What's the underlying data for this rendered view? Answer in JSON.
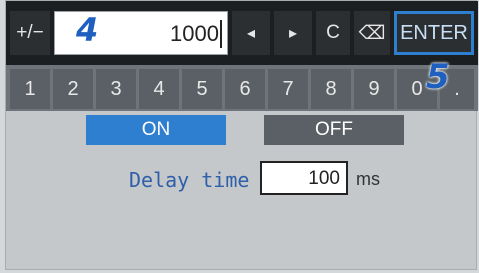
{
  "keypad": {
    "sign_key": "+/−",
    "entry_value": "1000",
    "left_key": "◂",
    "right_key": "▸",
    "clear_key": "C",
    "backspace_key": "⌫",
    "enter_key": "ENTER"
  },
  "callouts": {
    "step_4": "4",
    "step_5": "5"
  },
  "number_keys": [
    "1",
    "2",
    "3",
    "4",
    "5",
    "6",
    "7",
    "8",
    "9",
    "0",
    "."
  ],
  "toggle": {
    "on_label": "ON",
    "off_label": "OFF",
    "selected": "ON"
  },
  "delay": {
    "label": "Delay time",
    "value": "100",
    "unit": "ms"
  },
  "colors": {
    "accent": "#2f7fd0",
    "callout": "#1f5fbf"
  }
}
